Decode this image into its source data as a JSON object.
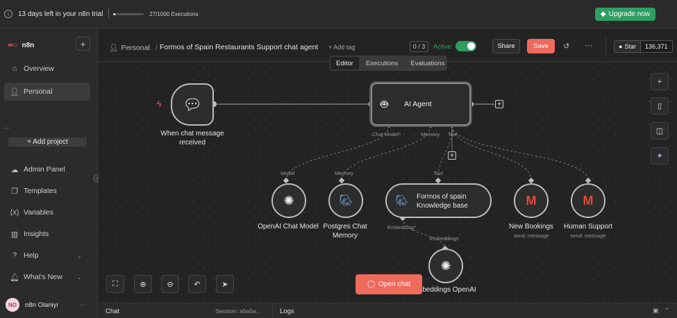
{
  "trial": {
    "text": "13 days left in your n8n trial",
    "executions": "27/1000 Executions",
    "progress_fraction": 0.027,
    "upgrade_label": "Upgrade now"
  },
  "sidebar": {
    "brand": "n8n",
    "items": [
      {
        "label": "Overview",
        "icon": "home-icon"
      },
      {
        "label": "Personal",
        "icon": "user-icon"
      }
    ],
    "add_project": "+ Add project",
    "bottom_items": [
      {
        "label": "Admin Panel",
        "icon": "cloud-icon"
      },
      {
        "label": "Templates",
        "icon": "templates-icon"
      },
      {
        "label": "Variables",
        "icon": "variables-icon"
      },
      {
        "label": "Insights",
        "icon": "insights-icon"
      },
      {
        "label": "Help",
        "icon": "help-icon"
      },
      {
        "label": "What's New",
        "icon": "bell-icon"
      }
    ],
    "user": {
      "initials": "NO",
      "name": "n8n Olaniyi"
    }
  },
  "header": {
    "breadcrumb_project": "Personal",
    "separator": "/",
    "workflow_name": "Formos of Spain Restaurants Support chat agent",
    "add_tag": "+ Add tag",
    "counter": "0 / 3",
    "active_label": "Active",
    "share_label": "Share",
    "save_label": "Save",
    "github_star": "Star",
    "github_count": "136,371"
  },
  "tabs": [
    "Editor",
    "Executions",
    "Evaluations"
  ],
  "nodes": {
    "trigger": {
      "label_line1": "When chat message",
      "label_line2": "received"
    },
    "agent": {
      "title": "AI Agent",
      "ports": [
        "Chat Model*",
        "Memory",
        "Tool"
      ]
    },
    "openai_chat": {
      "port": "Model",
      "label": "OpenAI Chat Model"
    },
    "postgres": {
      "port": "Memory",
      "label_line1": "Postgres Chat",
      "label_line2": "Memory"
    },
    "kb": {
      "port": "Tool",
      "title_line1": "Formos of spain",
      "title_line2": "Knowledge base",
      "embedding_port": "Embedding*"
    },
    "embeddings": {
      "port": "Embeddings",
      "label": "beddings OpenAI"
    },
    "new_bookings": {
      "label": "New Bookings",
      "sub": "send: message"
    },
    "human_support": {
      "label": "Human Support",
      "sub": "send: message"
    }
  },
  "canvas_controls": {
    "open_chat": "Open chat"
  },
  "bottom": {
    "chat": "Chat",
    "session": "Session: a5a5a...",
    "logs": "Logs"
  },
  "colors": {
    "accent": "#ee6a5c",
    "active_green": "#2f9e62",
    "background": "#232323"
  }
}
